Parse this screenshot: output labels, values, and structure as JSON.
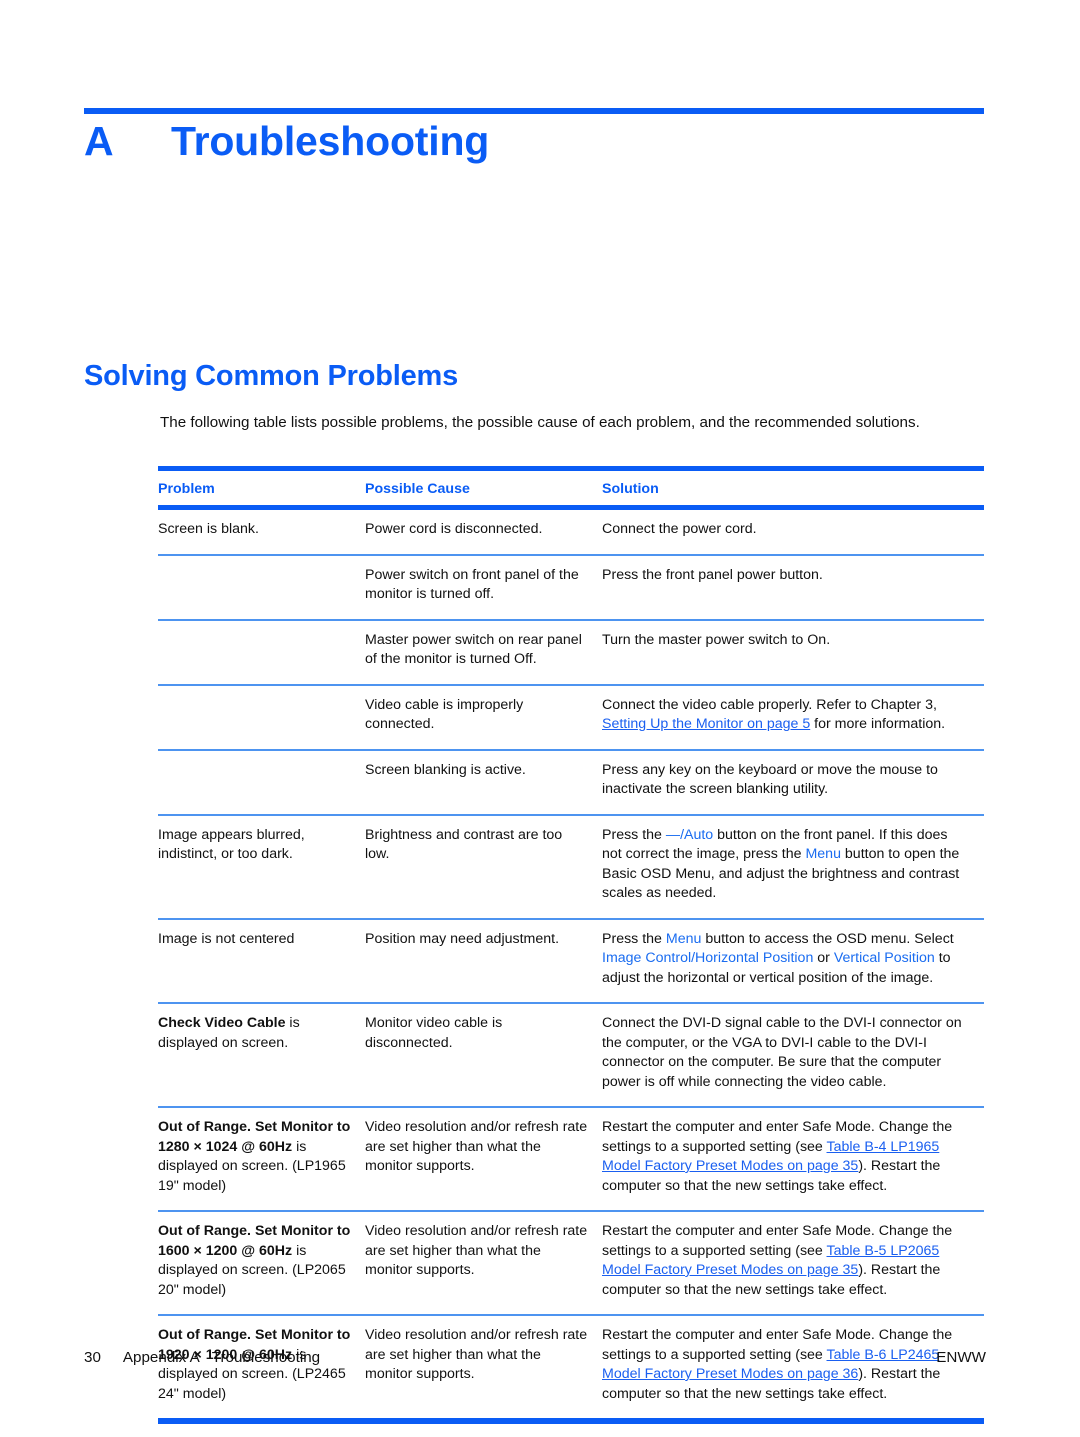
{
  "chapter": {
    "letter": "A",
    "title": "Troubleshooting"
  },
  "section": {
    "heading": "Solving Common Problems",
    "intro": "The following table lists possible problems, the possible cause of each problem, and the recommended solutions."
  },
  "table": {
    "headers": {
      "problem": "Problem",
      "cause": "Possible Cause",
      "solution": "Solution"
    },
    "rows": [
      {
        "problem": "Screen is blank.",
        "cause": "Power cord is disconnected.",
        "solution": "Connect the power cord."
      },
      {
        "problem": "",
        "cause": "Power switch on front panel of the monitor is turned off.",
        "solution": "Press the front panel power button."
      },
      {
        "problem": "",
        "cause": "Master power switch on rear panel of the monitor is turned Off.",
        "solution": "Turn the master power switch to On."
      },
      {
        "problem": "",
        "cause": "Video cable is improperly connected.",
        "solution_pre": "Connect the video cable properly. Refer to Chapter 3, ",
        "solution_link": "Setting Up the Monitor on page 5",
        "solution_post": " for more information."
      },
      {
        "problem": "",
        "cause": "Screen blanking is active.",
        "solution": "Press any key on the keyboard or move the mouse to inactivate the screen blanking utility."
      },
      {
        "problem": "Image appears blurred, indistinct, or too dark.",
        "cause": "Brightness and contrast are too low.",
        "solution_pre": "Press the ",
        "solution_term1": "—/Auto",
        "solution_mid": " button on the front panel. If this does not correct the image, press the ",
        "solution_term2": "Menu",
        "solution_post": " button to open the Basic OSD Menu, and adjust the brightness and contrast scales as needed."
      },
      {
        "problem": "Image is not centered",
        "cause": "Position may need adjustment.",
        "solution_pre": "Press the ",
        "solution_term1": "Menu",
        "solution_mid": " button to access the OSD menu. Select ",
        "solution_term2": "Image Control/Horizontal Position",
        "solution_mid2": " or ",
        "solution_term3": "Vertical Position",
        "solution_post": " to adjust the horizontal or vertical position of the image."
      },
      {
        "problem_bold": "Check Video Cable",
        "problem_rest": " is displayed on screen.",
        "cause": "Monitor video cable is disconnected.",
        "solution": "Connect the DVI-D signal cable to the DVI-I connector on the computer, or the VGA to DVI-I cable to the DVI-I connector on the computer. Be sure that the computer power is off while connecting the video cable."
      },
      {
        "problem_bold": "Out of Range. Set Monitor to 1280 × 1024 @ 60Hz",
        "problem_rest": " is displayed on screen. (LP1965 19\" model)",
        "cause": "Video resolution and/or refresh rate are set higher than what the monitor supports.",
        "solution_pre": "Restart the computer and enter Safe Mode. Change the settings to a supported setting (see ",
        "solution_link": "Table B-4 LP1965 Model Factory Preset Modes on page 35",
        "solution_post": "). Restart the computer so that the new settings take effect."
      },
      {
        "problem_bold": "Out of Range. Set Monitor to 1600 × 1200 @ 60Hz",
        "problem_rest": " is displayed on screen. (LP2065 20\" model)",
        "cause": "Video resolution and/or refresh rate are set higher than what the monitor supports.",
        "solution_pre": "Restart the computer and enter Safe Mode. Change the settings to a supported setting (see ",
        "solution_link": "Table B-5 LP2065 Model Factory Preset Modes on page 35",
        "solution_post": "). Restart the computer so that the new settings take effect."
      },
      {
        "problem_bold": "Out of Range. Set Monitor to 1920 × 1200 @ 60Hz",
        "problem_rest": " is displayed on screen. (LP2465 24\" model)",
        "cause": "Video resolution and/or refresh rate are set higher than what the monitor supports.",
        "solution_pre": "Restart the computer and enter Safe Mode. Change the settings to a supported setting (see ",
        "solution_link": "Table B-6 LP2465 Model Factory Preset Modes on page 36",
        "solution_post": "). Restart the computer so that the new settings take effect."
      }
    ]
  },
  "footer": {
    "page_number": "30",
    "appendix": "Appendix A",
    "chapter_title": "Troubleshooting",
    "locale": "ENWW"
  },
  "colors": {
    "accent_blue": "#0a5cf5",
    "rule_light_blue": "#4d94f0",
    "link_blue": "#1a5ff0"
  }
}
